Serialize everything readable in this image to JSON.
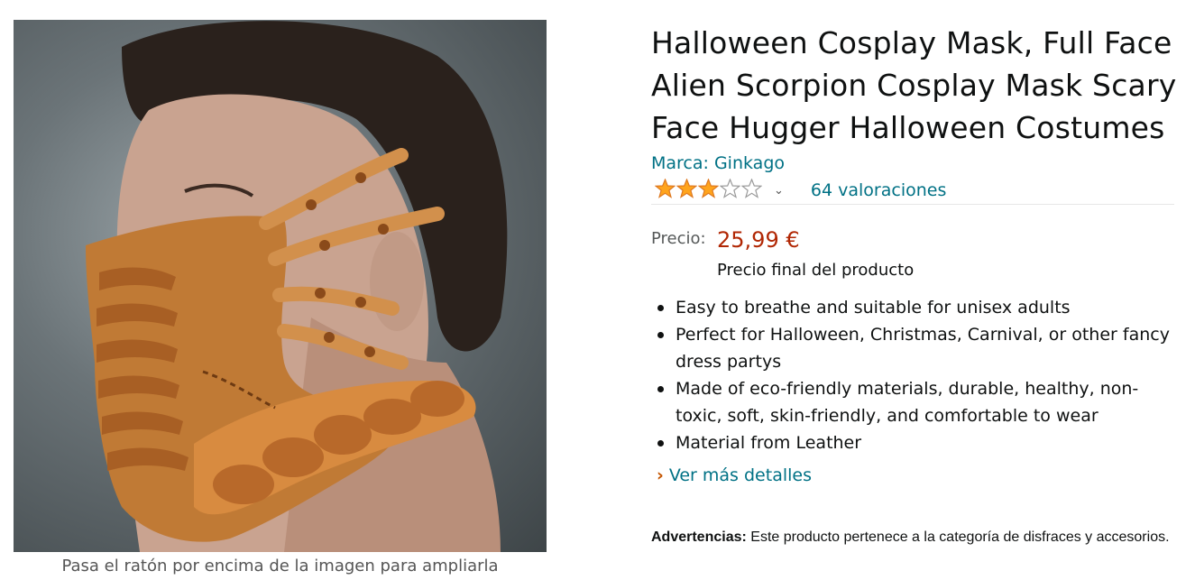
{
  "product": {
    "title": "Halloween Cosplay Mask, Full Face Alien Scorpion Cosplay Mask Scary Face Hugger Halloween Costumes",
    "brand": "Marca: Ginkago",
    "image_caption": "Pasa el ratón por encima de la imagen para ampliarla"
  },
  "rating": {
    "stars": 3,
    "max_stars": 5,
    "count_label": "64 valoraciones",
    "star_color": "#FFA41C"
  },
  "price": {
    "label": "Precio:",
    "value": "25,99 €",
    "note": "Precio final del producto",
    "color": "#B12704"
  },
  "bullets": [
    "Easy to breathe and suitable for unisex adults",
    "Perfect for Halloween, Christmas, Carnival, or other fancy dress partys",
    "Made of eco-friendly materials, durable, healthy, non-toxic, soft, skin-friendly, and comfortable to wear",
    "Material from Leather"
  ],
  "more_details": {
    "label": "Ver más detalles",
    "icon": "chevron-right-icon"
  },
  "warning": {
    "label": "Advertencias:",
    "text": " Este producto pertenece a la categoría de disfraces y accesorios."
  },
  "colors": {
    "link": "#007185",
    "text": "#0f1111"
  }
}
